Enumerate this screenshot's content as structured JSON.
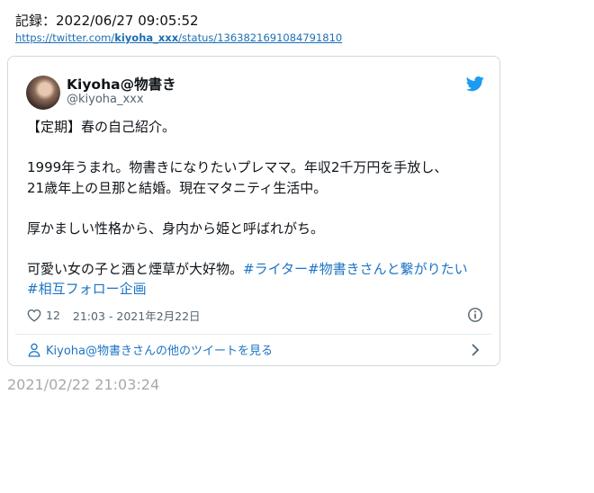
{
  "record": "記録：2022/06/27 09:05:52",
  "source": {
    "prefix": "https://twitter.com/",
    "user": "kiyoha_xxx",
    "suffix": "/status/1363821691084791810"
  },
  "tweet": {
    "author_name": "Kiyoha@物書き",
    "author_handle": "@kiyoha_xxx",
    "line1": "【定期】春の自己紹介。",
    "line2": "1999年うまれ。物書きになりたいプレママ。年収2千万円を手放し、",
    "line3": "21歳年上の旦那と結婚。現在マタニティ生活中。",
    "line4": "厚かましい性格から、身内から姫と呼ばれがち。",
    "line5_text": "可愛い女の子と酒と煙草が大好物。",
    "hashtag1": "#ライター",
    "hashtag2": "#物書きさんと繋がりたい",
    "hashtag3": "#相互フォロー企画",
    "likes": "12",
    "datetime": "21:03 - 2021年2月22日",
    "more_link": "Kiyoha@物書きさんの他のツイートを見る"
  },
  "capture_time": "2021/02/22 21:03:24",
  "colors": {
    "link": "#1d74c4",
    "twitter_blue": "#1d9bf0",
    "muted": "#536471"
  },
  "icons": [
    "twitter-bird-icon",
    "heart-icon",
    "info-icon",
    "person-icon",
    "chevron-right-icon"
  ]
}
